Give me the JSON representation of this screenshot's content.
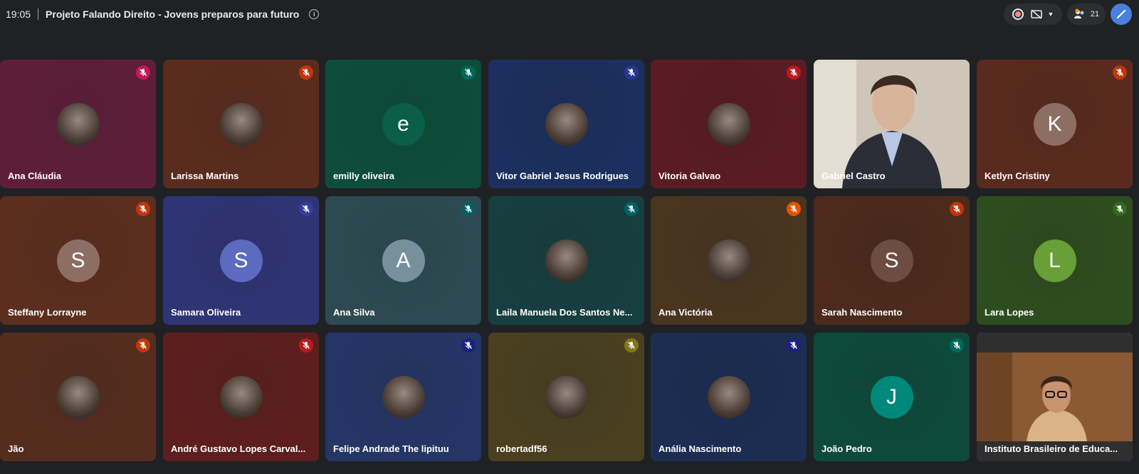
{
  "header": {
    "time": "19:05",
    "title": "Projeto Falando Direito - Jovens preparos para futuro",
    "participant_count": "21"
  },
  "colors": {
    "background": "#202124",
    "selected_outline": "#a8c7fa",
    "ai_button": "#4a7fe0"
  },
  "tiles": [
    {
      "name": "Ana Cláudia",
      "avatar_type": "photo",
      "letter": "",
      "bg": "#5e1e3a",
      "mic": "#c2185b"
    },
    {
      "name": "Larissa Martins",
      "avatar_type": "photo",
      "letter": "",
      "bg": "#5a2c1e",
      "mic": "#bf360c"
    },
    {
      "name": "emilly oliveira",
      "avatar_type": "letter",
      "letter": "e",
      "bg": "#0d4d3a",
      "mic": "#00695c",
      "avatar_bg": "#0b5e48"
    },
    {
      "name": "Vitor Gabriel Jesus Rodrigues",
      "avatar_type": "photo",
      "letter": "",
      "bg": "#1c2f5e",
      "mic": "#283593"
    },
    {
      "name": "Vitoria Galvao",
      "avatar_type": "photo",
      "letter": "",
      "bg": "#5a1c22",
      "mic": "#b71c1c"
    },
    {
      "name": "Gabriel Castro",
      "avatar_type": "video",
      "letter": "",
      "bg": "#c9bfb2",
      "mic": ""
    },
    {
      "name": "Ketlyn Cristiny",
      "avatar_type": "letter",
      "letter": "K",
      "bg": "#5a2a1e",
      "mic": "#bf360c",
      "avatar_bg": "#8d6e63"
    },
    {
      "name": "Steffany Lorrayne",
      "avatar_type": "letter",
      "letter": "S",
      "bg": "#5c2e1e",
      "mic": "#bf360c",
      "avatar_bg": "#8d6e63"
    },
    {
      "name": "Samara Oliveira",
      "avatar_type": "letter",
      "letter": "S",
      "bg": "#2f3475",
      "mic": "#303f9f",
      "avatar_bg": "#5c6bc0"
    },
    {
      "name": "Ana Silva",
      "avatar_type": "letter",
      "letter": "A",
      "bg": "#2d4a52",
      "mic": "#006064",
      "avatar_bg": "#78909c"
    },
    {
      "name": "Laila Manuela Dos Santos Ne...",
      "avatar_type": "photo",
      "letter": "",
      "bg": "#173f3f",
      "mic": "#006064"
    },
    {
      "name": "Ana Victória",
      "avatar_type": "photo",
      "letter": "",
      "bg": "#4a3520",
      "mic": "#e65100"
    },
    {
      "name": "Sarah Nascimento",
      "avatar_type": "letter",
      "letter": "S",
      "bg": "#4d2a1c",
      "mic": "#bf360c",
      "avatar_bg": "#6d4c41"
    },
    {
      "name": "Lara Lopes",
      "avatar_type": "letter",
      "letter": "L",
      "bg": "#2e4d1e",
      "mic": "#33691e",
      "avatar_bg": "#689f38"
    },
    {
      "name": "Jão",
      "avatar_type": "photo",
      "letter": "",
      "bg": "#552d1e",
      "mic": "#bf360c"
    },
    {
      "name": "André Gustavo Lopes Carval...",
      "avatar_type": "photo",
      "letter": "",
      "bg": "#5e1e1e",
      "mic": "#b71c1c"
    },
    {
      "name": "Felipe Andrade The lipituu",
      "avatar_type": "photo",
      "letter": "",
      "bg": "#253566",
      "mic": "#1a237e"
    },
    {
      "name": "robertadf56",
      "avatar_type": "photo",
      "letter": "",
      "bg": "#4a4020",
      "mic": "#827717"
    },
    {
      "name": "Anália Nascimento",
      "avatar_type": "photo",
      "letter": "",
      "bg": "#1c2d52",
      "mic": "#1a237e"
    },
    {
      "name": "João Pedro",
      "avatar_type": "letter",
      "letter": "J",
      "bg": "#0e4a3c",
      "mic": "#00695c",
      "avatar_bg": "#00897b"
    },
    {
      "name": "Instituto Brasileiro de Educa...",
      "avatar_type": "video",
      "letter": "",
      "bg": "#6b4a2a",
      "mic": ""
    }
  ]
}
